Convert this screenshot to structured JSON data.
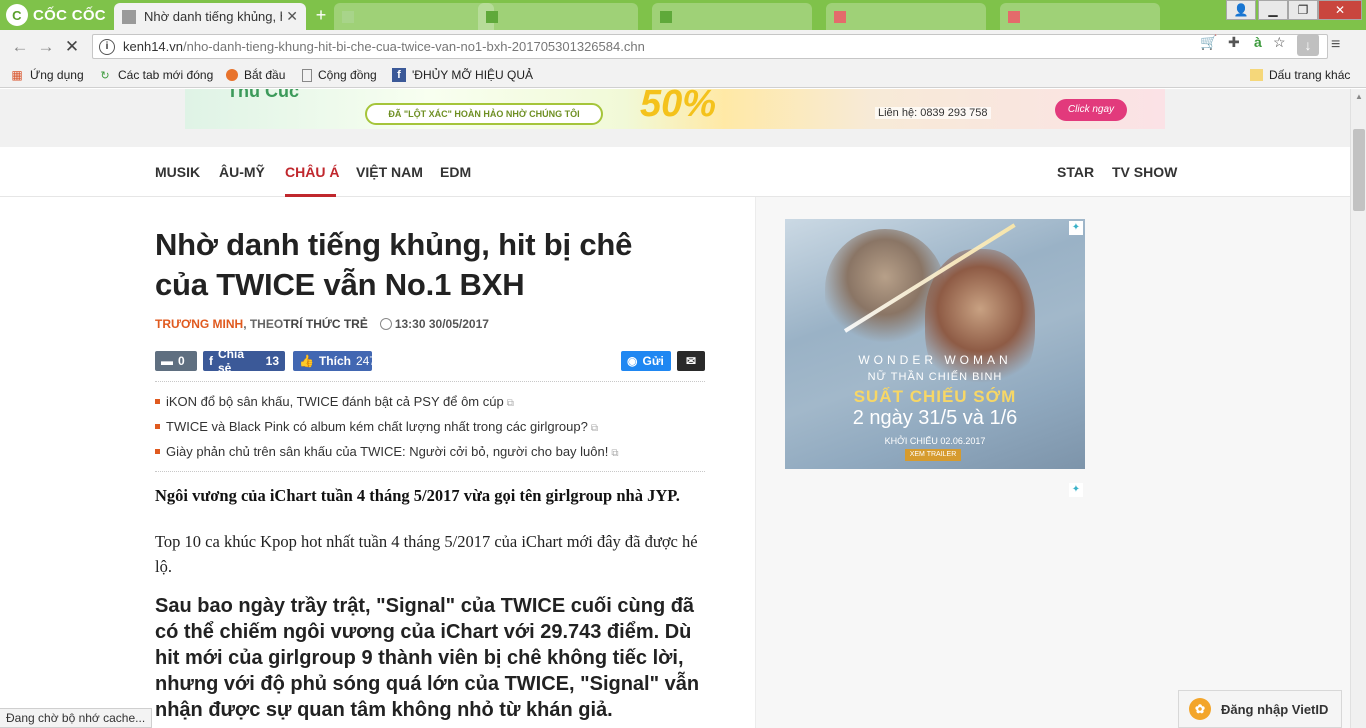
{
  "browser": {
    "brand": "CỐC CỐC",
    "active_tab": {
      "title": "Nhờ danh tiếng khủng, hit"
    },
    "url": {
      "host": "kenh14.vn",
      "path": "/nho-danh-tieng-khung-hit-bi-che-cua-twice-van-no1-bxh-201705301326584.chn"
    },
    "bookmarks": [
      "Ứng dụng",
      "Các tab mới đóng",
      "Bắt đầu",
      "Cộng đồng",
      "'ĐHỦY MỠ HIỆU QUẢ"
    ],
    "other_bookmarks": "Dấu trang khác",
    "status": "Đang chờ bộ nhớ cache..."
  },
  "banner": {
    "brand": "Thu Cúc",
    "slogan": "ĐÃ \"LỘT XÁC\" HOÀN HẢO NHỜ CHÚNG TÔI",
    "percent": "50%",
    "contact": "Liên hệ: 0839 293 758",
    "cta": "Click ngay"
  },
  "nav": {
    "left": [
      "MUSIK",
      "ÂU-MỸ",
      "CHÂU Á",
      "VIỆT NAM",
      "EDM"
    ],
    "right": [
      "STAR",
      "TV SHOW"
    ],
    "active": "CHÂU Á"
  },
  "article": {
    "title_line1": "Nhờ danh tiếng khủng, hit bị chê",
    "title_line2": "của TWICE vẫn No.1 BXH",
    "author": "TRƯƠNG MINH",
    "source_prefix": ", THEO ",
    "source": "TRÍ THỨC TRẺ",
    "time": "13:30 30/05/2017",
    "comments": "0",
    "share_label": "Chia sẻ",
    "share_count": "13",
    "like_label": "Thích",
    "like_count": "247",
    "messenger_label": "Gửi",
    "related": [
      "iKON đổ bộ sân khấu, TWICE đánh bật cả PSY để ôm cúp",
      "TWICE và Black Pink có album kém chất lượng nhất trong các girlgroup?",
      "Giày phản chủ trên sân khấu của TWICE: Người cởi bỏ, người cho bay luôn!"
    ],
    "sapo": "Ngôi vương của iChart tuần 4 tháng 5/2017 vừa gọi tên girlgroup nhà JYP.",
    "para1": "Top 10 ca khúc Kpop hot nhất tuần 4 tháng 5/2017 của iChart mới đây đã được hé lộ.",
    "para2": "Sau bao ngày trầy trật, \"Signal\" của TWICE cuối cùng đã có thể chiếm ngôi vương của iChart với 29.743 điểm. Dù hit mới của girlgroup 9 thành viên bị chê không tiếc lời, nhưng với độ phủ sóng quá lớn của TWICE, \"Signal\" vẫn nhận được sự quan tâm không nhỏ từ khán giả."
  },
  "side_ad": {
    "title": "WONDER WOMAN",
    "subtitle": "NỮ THẦN CHIẾN BINH",
    "headline": "SUẤT CHIẾU SỚM",
    "dates": "2 ngày 31/5 và 1/6",
    "release": "KHỞI CHIẾU 02.06.2017",
    "trailer": "XEM TRAILER"
  },
  "vietid": {
    "label": "Đăng nhập VietID"
  }
}
